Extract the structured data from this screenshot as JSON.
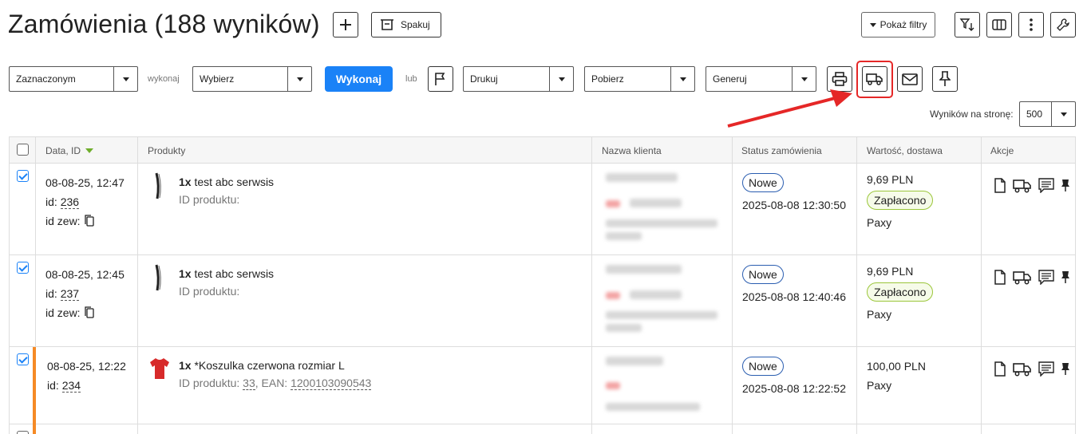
{
  "header": {
    "title": "Zamówienia (188 wyników)",
    "pack_label": "Spakuj",
    "filters_label": "Pokaż filtry"
  },
  "toolbar": {
    "selection_value": "Zaznaczonym",
    "wykonaj_small": "wykonaj",
    "action_value": "Wybierz",
    "execute_label": "Wykonaj",
    "or_label": "lub",
    "print_value": "Drukuj",
    "download_value": "Pobierz",
    "generate_value": "Generuj",
    "per_page_label": "Wyników na stronę:",
    "per_page_value": "500"
  },
  "table": {
    "headers": {
      "date": "Data, ID",
      "products": "Produkty",
      "client": "Nazwa klienta",
      "status": "Status zamówienia",
      "value": "Wartość, dostawa",
      "actions": "Akcje"
    },
    "rows": [
      {
        "date": "08-08-25, 12:47",
        "id_label": "id:",
        "id": "236",
        "ext_label": "id zew:",
        "qty": "1x",
        "product": "test abc serwsis",
        "product_id_label": "ID produktu:",
        "status": "Nowe",
        "status_time": "2025-08-08 12:30:50",
        "price": "9,69 PLN",
        "paid": "Zapłacono",
        "delivery": "Paxy"
      },
      {
        "date": "08-08-25, 12:45",
        "id_label": "id:",
        "id": "237",
        "ext_label": "id zew:",
        "qty": "1x",
        "product": "test abc serwsis",
        "product_id_label": "ID produktu:",
        "status": "Nowe",
        "status_time": "2025-08-08 12:40:46",
        "price": "9,69 PLN",
        "paid": "Zapłacono",
        "delivery": "Paxy"
      },
      {
        "date": "08-08-25, 12:22",
        "id_label": "id:",
        "id": "234",
        "qty": "1x",
        "product": "*Koszulka czerwona rozmiar L",
        "product_id_label": "ID produktu:",
        "product_id": "33",
        "ean_label": ", EAN:",
        "ean": "1200103090543",
        "status": "Nowe",
        "status_time": "2025-08-08 12:22:52",
        "price": "100,00 PLN",
        "delivery": "Paxy"
      }
    ]
  },
  "colors": {
    "accent": "#1a82f7",
    "highlight": "#e52727",
    "row_marker": "#f58a25",
    "paid_border": "#9bc63a"
  }
}
